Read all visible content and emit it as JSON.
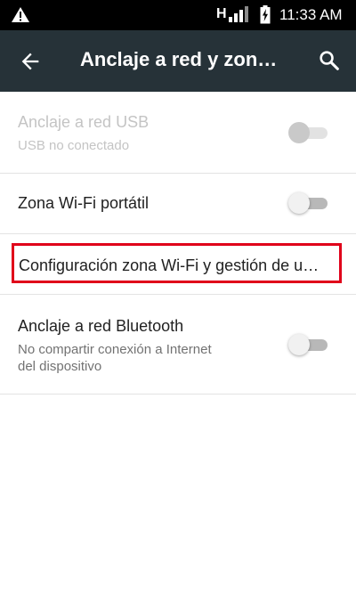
{
  "status_bar": {
    "network_label": "H",
    "time": "11:33 AM",
    "icons": [
      "warning-icon",
      "signal-icon",
      "battery-charging-icon"
    ]
  },
  "app_bar": {
    "title": "Anclaje a red y zon…",
    "icons": [
      "back-arrow-icon",
      "search-icon"
    ]
  },
  "settings": [
    {
      "title": "Anclaje a red USB",
      "subtitle": "USB no conectado",
      "enabled": false,
      "toggle_on": false
    },
    {
      "title": "Zona Wi-Fi portátil",
      "enabled": true,
      "toggle_on": false
    },
    {
      "title": "Configuración zona Wi-Fi y gestión de u…",
      "enabled": true,
      "highlighted": true
    },
    {
      "title": "Anclaje a red Bluetooth",
      "subtitle_line1": "No compartir conexión a Internet",
      "subtitle_line2": "del dispositivo",
      "enabled": true,
      "toggle_on": false
    }
  ],
  "colors": {
    "status_bar": "#000000",
    "app_bar": "#263238",
    "highlight_border": "#e0001a"
  }
}
